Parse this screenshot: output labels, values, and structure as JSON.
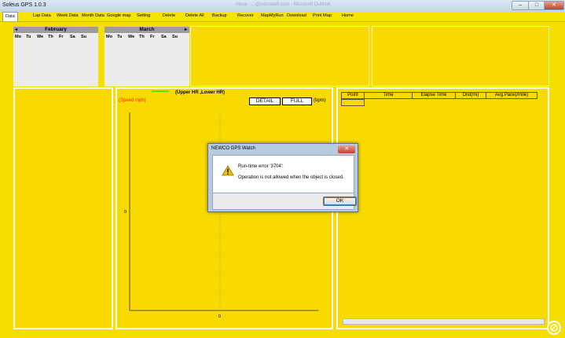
{
  "window": {
    "title": "Soleus GPS 1.0.3",
    "ghost_tabs": "Inbox - ...@microsoft.com - Microsoft Outlook",
    "min": "–",
    "max": "□",
    "close": "✕"
  },
  "menu": [
    "Data",
    "Lap Data",
    "Week Data",
    "Month Data",
    "Google map",
    "Setting",
    "Delete",
    "Delete All",
    "Backup",
    "Recover",
    "MapMyRun",
    "Download",
    "Print Map",
    "Home"
  ],
  "calendar": {
    "left_month": "February",
    "right_month": "March",
    "prev": "◂",
    "next": "▸",
    "days": [
      "Mo",
      "Tu",
      "We",
      "Th",
      "Fr",
      "Sa",
      "Su"
    ]
  },
  "chart": {
    "legend": "(Upper HR ,Lower HR)",
    "left_label": "(Speed mph)",
    "right_label": "(bpm)",
    "detail_button": "DETAIL",
    "full_button": "FULL",
    "y_tick": "0",
    "x_tick": "0"
  },
  "chart_data": {
    "type": "line",
    "series": [],
    "legend": [
      "(Upper HR ,Lower HR)"
    ],
    "ylabel": "(Speed mph)",
    "y2label": "(bpm)",
    "yticks": [
      "0"
    ],
    "xticks": [
      "0"
    ]
  },
  "table": {
    "columns": [
      "Point",
      "Time",
      "Elapse Time",
      "Dist(mi)",
      "Avg.Pace(/mile)"
    ]
  },
  "dialog": {
    "title": "NEWCO GPS Watch",
    "message1": "Run-time error '3704':",
    "message2": "Operation is not allowed when the object is closed.",
    "ok": "OK",
    "close": "✕"
  },
  "colors": {
    "app_yellow": "#f6df00",
    "legend_green": "#22dd22",
    "speed_red": "#ff2222",
    "dialog_frame": "#b7cbe0"
  }
}
